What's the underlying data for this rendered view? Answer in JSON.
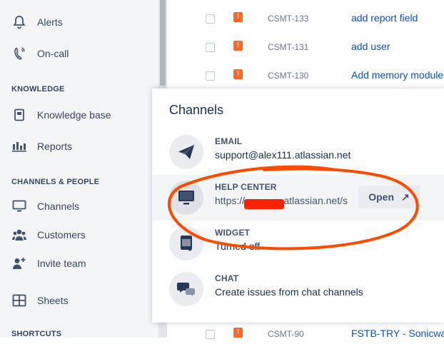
{
  "sidebar": {
    "alerts": "Alerts",
    "oncall": "On-call",
    "knowledge_heading": "KNOWLEDGE",
    "knowledge_base": "Knowledge base",
    "reports": "Reports",
    "channels_heading": "CHANNELS & PEOPLE",
    "channels": "Channels",
    "customers": "Customers",
    "invite_team": "Invite team",
    "sheets": "Sheets",
    "shortcuts_heading": "SHORTCUTS"
  },
  "issues": [
    {
      "key": "CSMT-133",
      "summary": "add report field"
    },
    {
      "key": "CSMT-131",
      "summary": "add user"
    },
    {
      "key": "CSMT-130",
      "summary": "Add memory module"
    },
    {
      "key": "CSMT-90",
      "summary": "FSTB-TRY - Sonicwall"
    }
  ],
  "priority_glyph": "!",
  "popup": {
    "title": "Channels",
    "email": {
      "label": "EMAIL",
      "value": "support@alex111.atlassian.net"
    },
    "help_center": {
      "label": "HELP CENTER",
      "value": "https://              atlassian.net/se",
      "open_label": "Open",
      "open_icon": "↗"
    },
    "widget": {
      "label": "WIDGET",
      "value": "Turned off"
    },
    "chat": {
      "label": "CHAT",
      "value": "Create issues from chat channels"
    }
  },
  "colors": {
    "accent": "#0052cc",
    "priority": "#f56a2a",
    "annotation": "#ff4a00"
  }
}
